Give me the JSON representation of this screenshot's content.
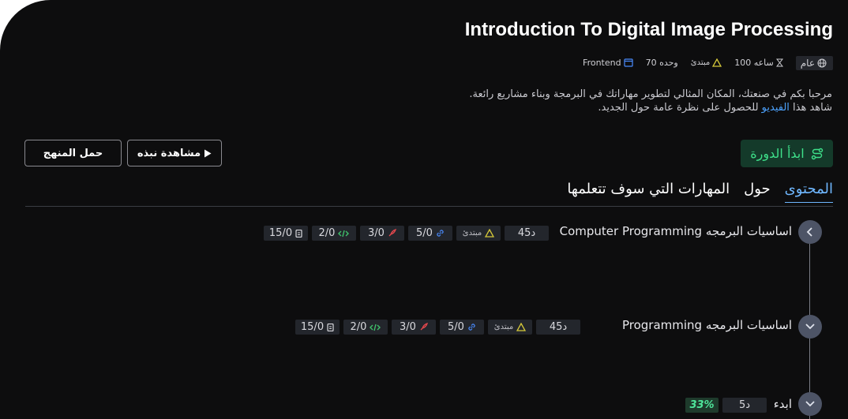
{
  "course": {
    "title": "Introduction To Digital Image Processing",
    "meta": {
      "visibility": "عام",
      "hours": "100 ساعه",
      "level": "مبتدئ",
      "units": "70 وحده",
      "track": "Frontend"
    },
    "intro_line1": "مرحبا بكم في صنعتك، المكان المثالي لتطوير مهاراتك في البرمجة وبناء مشاريع رائعة.",
    "intro_line2_pre": "شاهد هذا ",
    "intro_line2_link": "الفيديو",
    "intro_line2_post": " للحصول على نظرة عامة حول الجديد."
  },
  "actions": {
    "start": "ابدأ الدورة",
    "preview": "مشاهدة نبذه",
    "download": "حمل المنهج"
  },
  "tabs": [
    {
      "label": "المحتوى",
      "active": true
    },
    {
      "label": "حول",
      "active": false
    },
    {
      "label": "المهارات التي سوف تتعلمها",
      "active": false
    }
  ],
  "modules": [
    {
      "title": "اساسيات البرمجه Computer Programming",
      "duration": "45د",
      "level": "مبتدئ",
      "links": "5/0",
      "projects": "3/0",
      "exercises": "2/0",
      "quizzes": "15/0"
    },
    {
      "title": "اساسيات البرمجه  Programming",
      "duration": "45د",
      "level": "مبتدئ",
      "links": "5/0",
      "projects": "3/0",
      "exercises": "2/0",
      "quizzes": "15/0"
    },
    {
      "title": "ابدء",
      "duration": "5د",
      "progress": "33%"
    }
  ],
  "icons": {
    "visibility": "globe-icon",
    "hours": "hourglass-icon",
    "level": "triangle-icon",
    "track": "window-icon",
    "start": "route-icon",
    "preview": "play-icon",
    "links": "link-icon",
    "projects": "rocket-icon",
    "exercises": "code-icon",
    "quizzes": "document-icon",
    "expand": "chevron-down-icon",
    "collapse": "chevron-left-icon"
  },
  "colors": {
    "background": "#0d0d0e",
    "accent_green": "#3ee08a",
    "link_blue": "#4da3ff",
    "level_yellow": "#d6c93a",
    "project_red": "#e5484d",
    "exercise_green": "#3fbf6a",
    "link_icon_blue": "#4a8cff"
  }
}
